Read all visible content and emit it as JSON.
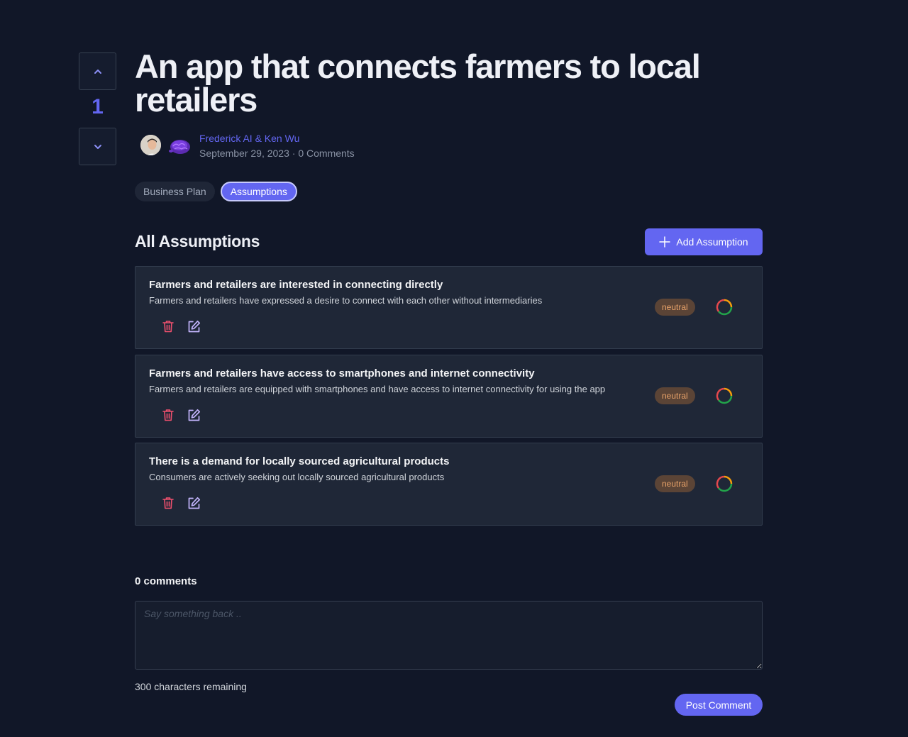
{
  "vote": {
    "count": "1"
  },
  "post": {
    "title": "An app that connects farmers to local retailers",
    "authors": "Frederick AI & Ken Wu",
    "date": "September 29, 2023",
    "separator": " · ",
    "comments_count": "0 Comments"
  },
  "tabs": [
    {
      "label": "Business Plan",
      "active": false
    },
    {
      "label": "Assumptions",
      "active": true
    }
  ],
  "assumptions": {
    "heading": "All Assumptions",
    "add_label": "Add Assumption",
    "items": [
      {
        "title": "Farmers and retailers are interested in connecting directly",
        "description": "Farmers and retailers have expressed a desire to connect with each other without intermediaries",
        "status": "neutral"
      },
      {
        "title": "Farmers and retailers have access to smartphones and internet connectivity",
        "description": "Farmers and retailers are equipped with smartphones and have access to internet connectivity for using the app",
        "status": "neutral"
      },
      {
        "title": "There is a demand for locally sourced agricultural products",
        "description": "Consumers are actively seeking out locally sourced agricultural products",
        "status": "neutral"
      }
    ]
  },
  "comments": {
    "heading": "0 comments",
    "placeholder": "Say something back ..",
    "chars_remaining": "300 characters remaining",
    "post_label": "Post Comment"
  },
  "colors": {
    "background": "#111728",
    "accent": "#6366f1",
    "card": "#1f2737",
    "delete": "#f0506e",
    "neutral_badge_bg": "#5b4436",
    "neutral_badge_text": "#e9a36a"
  },
  "icons": [
    "chevron-up-icon",
    "chevron-down-icon",
    "plus-icon",
    "trash-icon",
    "edit-icon",
    "status-ring-icon"
  ]
}
